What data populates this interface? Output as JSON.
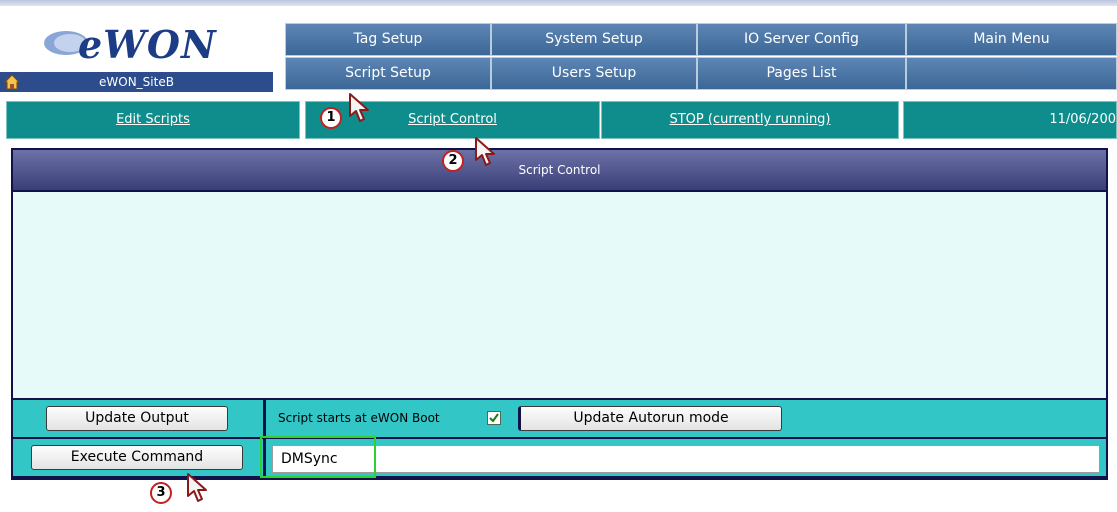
{
  "logo": {
    "text": "eWON"
  },
  "site": {
    "name": "eWON_SiteB",
    "icon": "home-icon"
  },
  "menu": {
    "row1": [
      "Tag Setup",
      "System Setup",
      "IO Server Config",
      "Main Menu"
    ],
    "row2": [
      "Script Setup",
      "Users Setup",
      "Pages List",
      ""
    ]
  },
  "subnav": {
    "edit_scripts": "Edit Scripts",
    "script_control": "Script Control",
    "stop": "STOP (currently running)",
    "date": "11/06/200"
  },
  "panel": {
    "title": "Script Control",
    "output": "",
    "update_output_label": "Update Output",
    "autorun_label": "Script starts at eWON Boot",
    "autorun_checked": true,
    "update_autorun_label": "Update Autorun mode",
    "execute_label": "Execute Command",
    "command_value": "DMSync"
  },
  "callouts": [
    "1",
    "2",
    "3"
  ],
  "colors": {
    "menu_blue": "#4a74a5",
    "subnav_teal": "#0f8c8c",
    "row_cyan": "#33c6c6",
    "panel_navy": "#12124a",
    "output_bg": "#e7fafa",
    "highlight_green": "#2ed12e",
    "callout_red": "#c22121"
  }
}
